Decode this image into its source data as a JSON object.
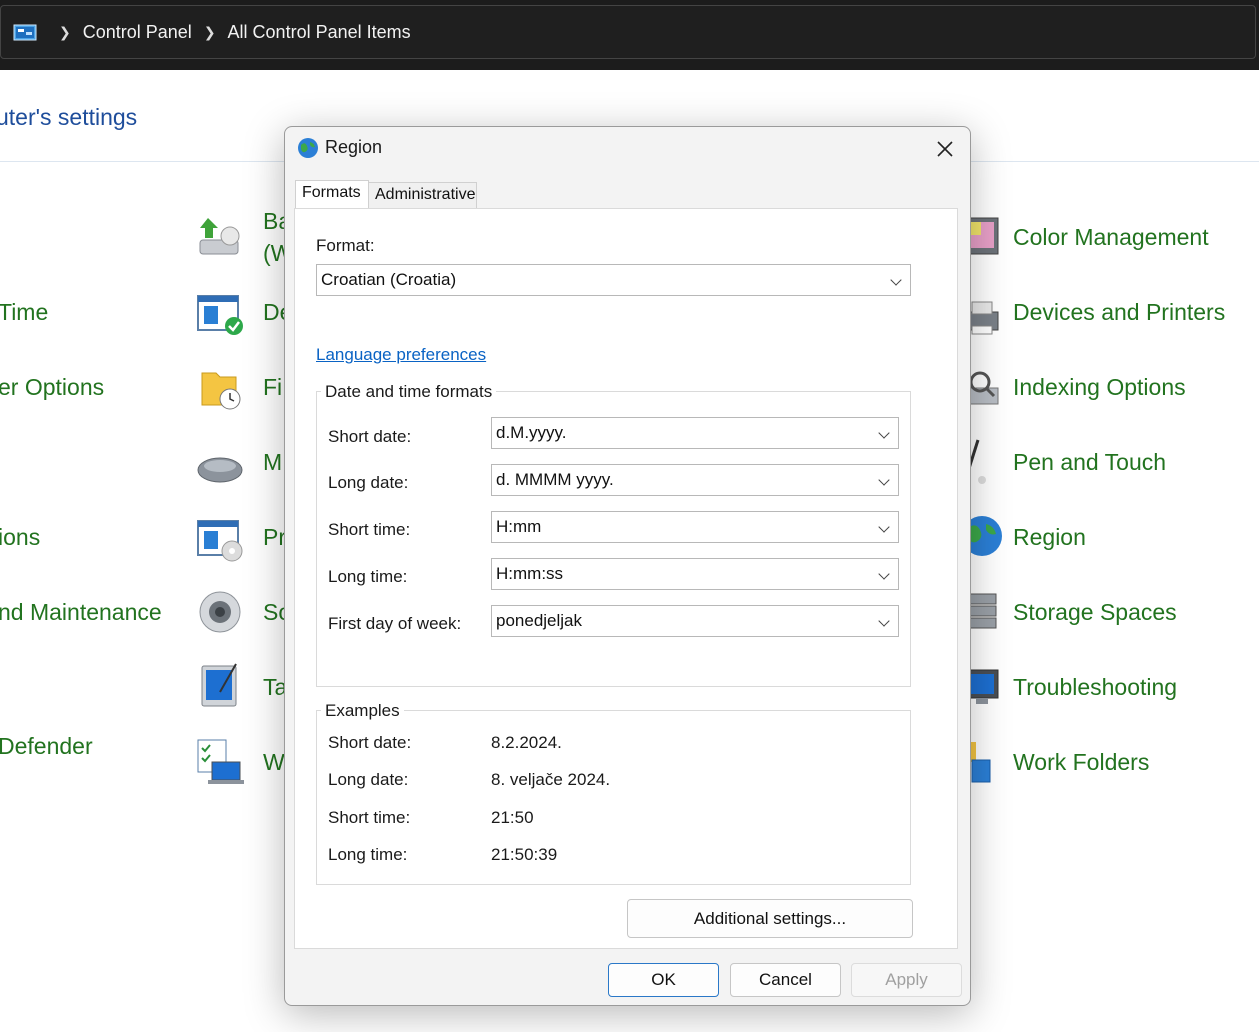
{
  "address_bar": {
    "crumbs": [
      "Control Panel",
      "All Control Panel Items"
    ],
    "icon": "control-panel-icon"
  },
  "background": {
    "heading": "uter's settings",
    "left_items": [
      "Time",
      "er Options",
      "ions",
      "nd Maintenance",
      "Defender"
    ],
    "middle_items": [
      "Ba",
      "(W",
      "De",
      "Fi",
      "M",
      "Pr",
      "So",
      "Ta",
      "W"
    ],
    "right_items": [
      "Color Management",
      "Devices and Printers",
      "Indexing Options",
      "Pen and Touch",
      "Region",
      "Storage Spaces",
      "Troubleshooting",
      "Work Folders"
    ]
  },
  "dialog": {
    "title": "Region",
    "tabs": [
      "Formats",
      "Administrative"
    ],
    "format_label": "Format:",
    "format_value": "Croatian (Croatia)",
    "language_link": "Language preferences",
    "dt_group_title": "Date and time formats",
    "fields": [
      {
        "label": "Short date:",
        "value": "d.M.yyyy."
      },
      {
        "label": "Long date:",
        "value": "d. MMMM yyyy."
      },
      {
        "label": "Short time:",
        "value": "H:mm"
      },
      {
        "label": "Long time:",
        "value": "H:mm:ss"
      },
      {
        "label": "First day of week:",
        "value": "ponedjeljak"
      }
    ],
    "examples_title": "Examples",
    "examples": [
      {
        "label": "Short date:",
        "value": "8.2.2024."
      },
      {
        "label": "Long date:",
        "value": "8. veljače 2024."
      },
      {
        "label": "Short time:",
        "value": "21:50"
      },
      {
        "label": "Long time:",
        "value": "21:50:39"
      }
    ],
    "additional_settings": "Additional settings...",
    "ok": "OK",
    "cancel": "Cancel",
    "apply": "Apply"
  }
}
